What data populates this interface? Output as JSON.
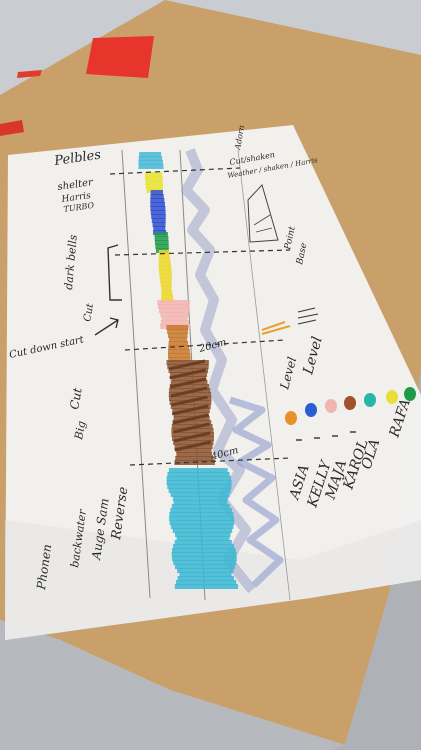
{
  "photo": {
    "subject": "hand-annotated tracing paper on cardboard",
    "colors": {
      "floor": "#c9ccd0",
      "cardboard": "#c9a06a",
      "cardboard_shadow": "#b98d58",
      "paper": "#f3f3f1",
      "red_tape": "#e8352c",
      "ink": "#2a2a2a"
    }
  },
  "left_notes": [
    "Pelbles",
    "shelter",
    "Harris",
    "TURBO",
    "dark bells",
    "Cut",
    "Cut down start",
    "Cut",
    "Big",
    "Reverse",
    "Auge Sam",
    "backwater",
    "Phonen"
  ],
  "right_notes": [
    "Adorn",
    "Cut/shaken",
    "Weather / shaken / Harris",
    "Point",
    "Base",
    "Level",
    "Level"
  ],
  "depth_marks": [
    "20cm",
    "40cm"
  ],
  "legend": {
    "names": [
      "RAFA",
      "OLA",
      "KAROL",
      "MAJA",
      "KELLY",
      "ASIA"
    ],
    "dot_colors": [
      "#e8902c",
      "#2a5fd4",
      "#f1b4b0",
      "#a0522d",
      "#28b6a8",
      "#e8e03a",
      "#1f9a4a"
    ]
  },
  "core_segments": [
    {
      "color": "#47b8d6",
      "label": "cyan"
    },
    {
      "color": "#e7e430",
      "label": "yellow"
    },
    {
      "color": "#2f4fd0",
      "label": "blue"
    },
    {
      "color": "#1f9a4a",
      "label": "green"
    },
    {
      "color": "#ecd82c",
      "label": "yellow"
    },
    {
      "color": "#f3b5b0",
      "label": "pink"
    },
    {
      "color": "#c7782c",
      "label": "orange"
    },
    {
      "color": "#8a5230",
      "label": "brown"
    },
    {
      "color": "#3bb7d4",
      "label": "cyan"
    }
  ]
}
